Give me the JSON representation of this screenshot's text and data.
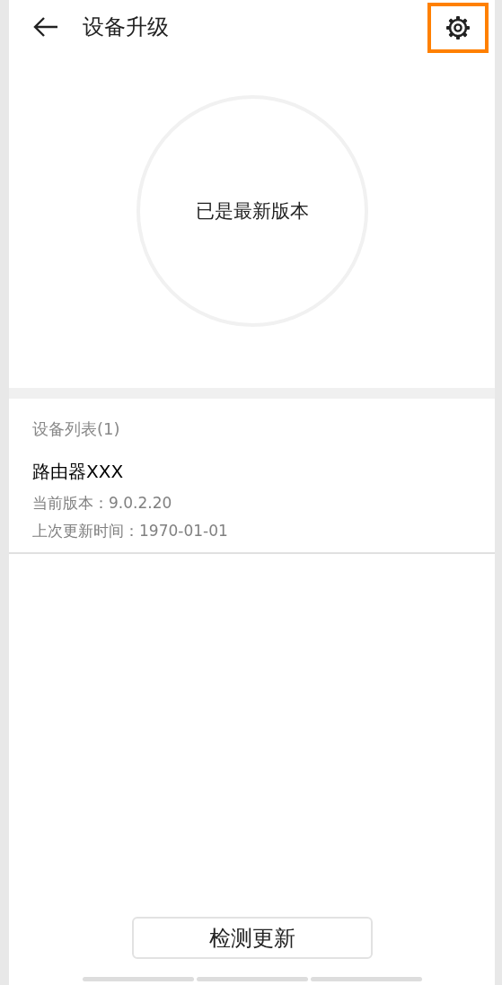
{
  "header": {
    "title": "设备升级",
    "settings_highlighted": true
  },
  "status": {
    "text": "已是最新版本"
  },
  "device_list": {
    "heading": "设备列表(1)",
    "devices": [
      {
        "name": "路由器XXX",
        "version": "当前版本：9.0.2.20",
        "last_update": "上次更新时间：1970-01-01"
      }
    ]
  },
  "check_button": {
    "label": "检测更新"
  }
}
